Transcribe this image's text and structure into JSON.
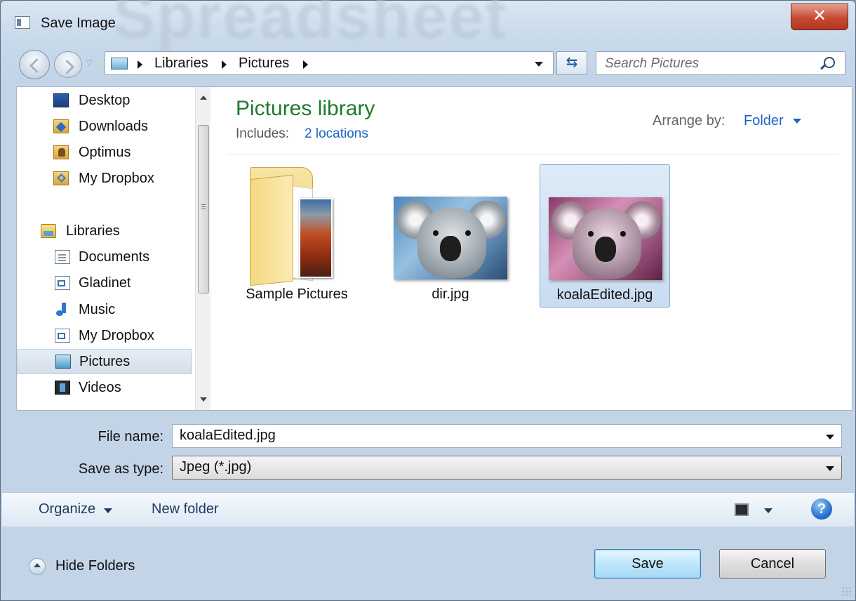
{
  "window": {
    "title": "Save Image",
    "close_label": "✕"
  },
  "address": {
    "crumbs": [
      "Libraries",
      "Pictures"
    ]
  },
  "search": {
    "placeholder": "Search Pictures"
  },
  "nav_pane": {
    "favorites": [
      {
        "label": "Desktop",
        "icon": "desktop-icon"
      },
      {
        "label": "Downloads",
        "icon": "downloads-icon"
      },
      {
        "label": "Optimus",
        "icon": "user-folder-icon"
      },
      {
        "label": "My Dropbox",
        "icon": "dropbox-icon"
      }
    ],
    "libraries_label": "Libraries",
    "libraries": [
      {
        "label": "Documents",
        "icon": "documents-icon"
      },
      {
        "label": "Gladinet",
        "icon": "gladinet-icon"
      },
      {
        "label": "Music",
        "icon": "music-icon"
      },
      {
        "label": "My Dropbox",
        "icon": "dropbox-library-icon"
      },
      {
        "label": "Pictures",
        "icon": "pictures-icon",
        "selected": true
      },
      {
        "label": "Videos",
        "icon": "videos-icon"
      }
    ]
  },
  "library_header": {
    "title": "Pictures library",
    "includes_label": "Includes:",
    "locations_link": "2 locations",
    "arrange_label": "Arrange by:",
    "arrange_value": "Folder"
  },
  "files": [
    {
      "name": "Sample Pictures",
      "type": "folder"
    },
    {
      "name": "dir.jpg",
      "type": "image"
    },
    {
      "name": "koalaEdited.jpg",
      "type": "image",
      "selected": true
    }
  ],
  "form": {
    "file_name_label": "File name:",
    "file_name_value": "koalaEdited.jpg",
    "save_type_label": "Save as type:",
    "save_type_value": "Jpeg (*.jpg)"
  },
  "toolbar": {
    "organize": "Organize",
    "new_folder": "New folder",
    "help": "?"
  },
  "footer": {
    "hide_folders": "Hide Folders",
    "save": "Save",
    "cancel": "Cancel"
  }
}
